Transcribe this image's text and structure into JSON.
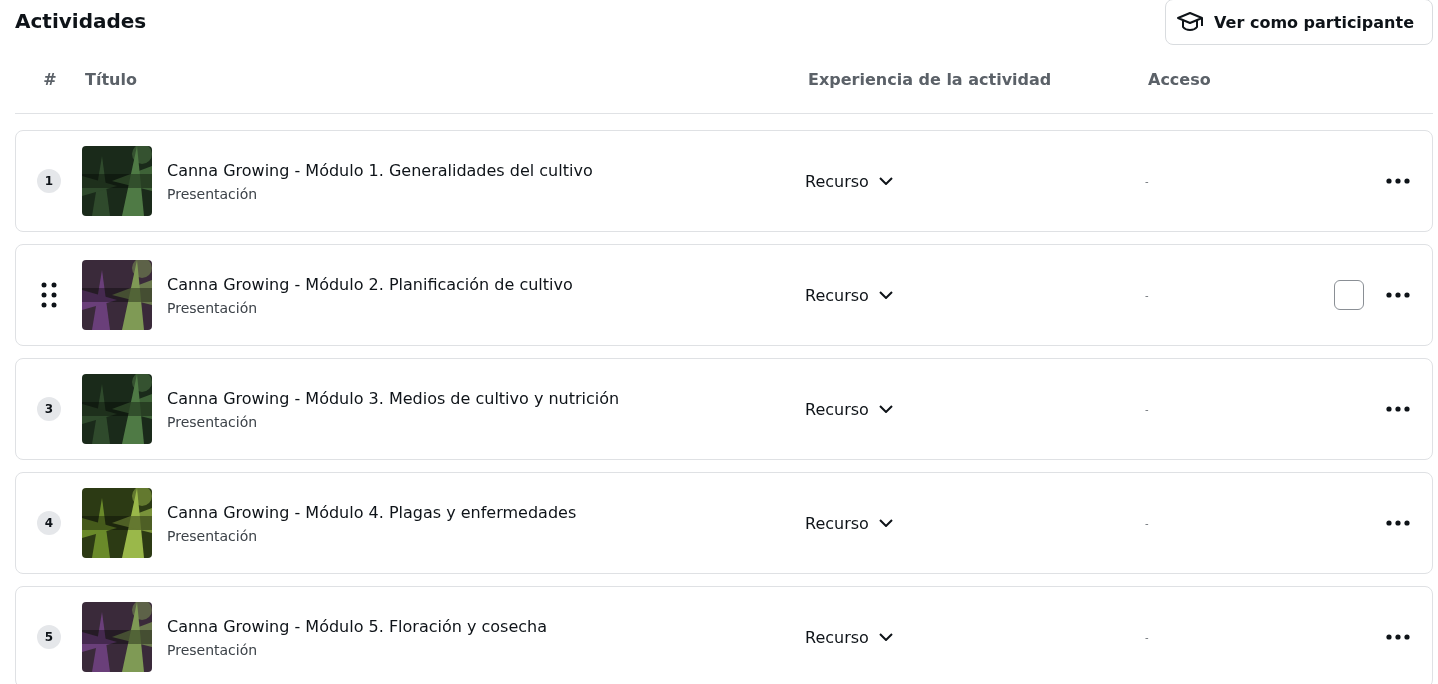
{
  "heading": "Actividades",
  "view_button": {
    "label": "Ver como participante"
  },
  "columns": [
    "#",
    "Título",
    "Experiencia de la actividad",
    "Acceso"
  ],
  "rows": [
    {
      "number": "1",
      "hovered": false,
      "title": "Canna Growing - Módulo 1. Generalidades del cultivo",
      "type": "Presentación",
      "experience": "Recurso",
      "access": "-"
    },
    {
      "hovered": true,
      "checked": false,
      "title": "Canna Growing - Módulo 2. Planificación de cultivo",
      "type": "Presentación",
      "experience": "Recurso",
      "access": "-"
    },
    {
      "number": "3",
      "hovered": false,
      "title": "Canna Growing - Módulo 3. Medios de cultivo y nutrición",
      "type": "Presentación",
      "experience": "Recurso",
      "access": "-"
    },
    {
      "number": "4",
      "hovered": false,
      "title": "Canna Growing - Módulo 4. Plagas y enfermedades",
      "type": "Presentación",
      "experience": "Recurso",
      "access": "-"
    },
    {
      "number": "5",
      "hovered": false,
      "title": "Canna Growing - Módulo 5. Floración y cosecha",
      "type": "Presentación",
      "experience": "Recurso",
      "access": "-"
    }
  ]
}
